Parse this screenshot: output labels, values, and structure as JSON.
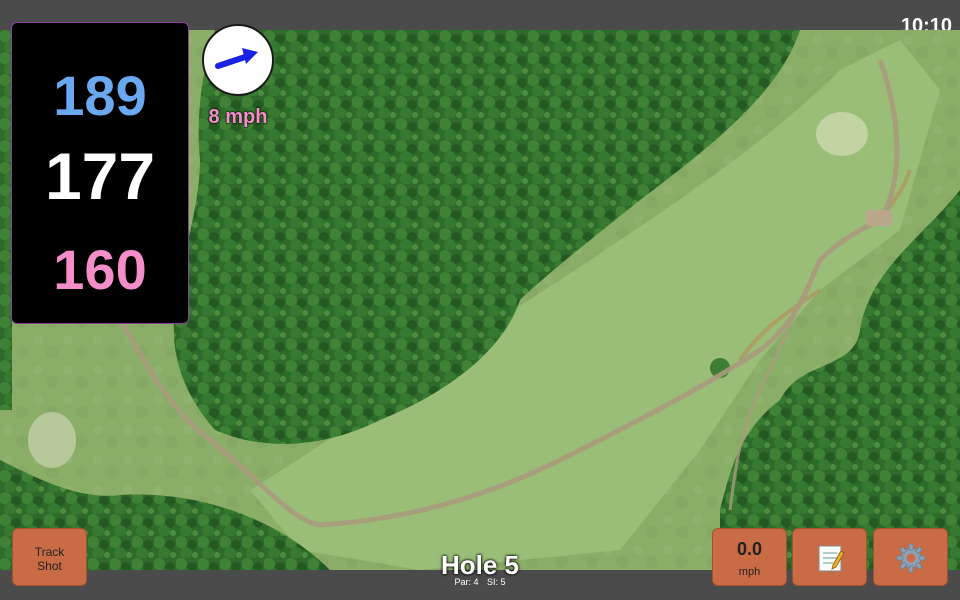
{
  "status_bar": {
    "time": "10:10"
  },
  "distances": {
    "back": "189",
    "middle": "177",
    "front": "160"
  },
  "wind": {
    "speed": "8 mph",
    "icon": "wind-direction-arrow-icon",
    "arrow_color": "#1a22e6"
  },
  "buttons": {
    "track_shot": "Track\nShot",
    "speed_value": "0.0",
    "speed_unit": "mph",
    "notes_icon": "notepad-icon",
    "settings_icon": "gear-icon",
    "button_color": "#c96b45"
  },
  "hole": {
    "title": "Hole 5",
    "par": "Par: 4",
    "si": "SI: 5"
  },
  "colors": {
    "back": "#6aa9ef",
    "middle": "#ffffff",
    "front": "#f38ec8"
  }
}
